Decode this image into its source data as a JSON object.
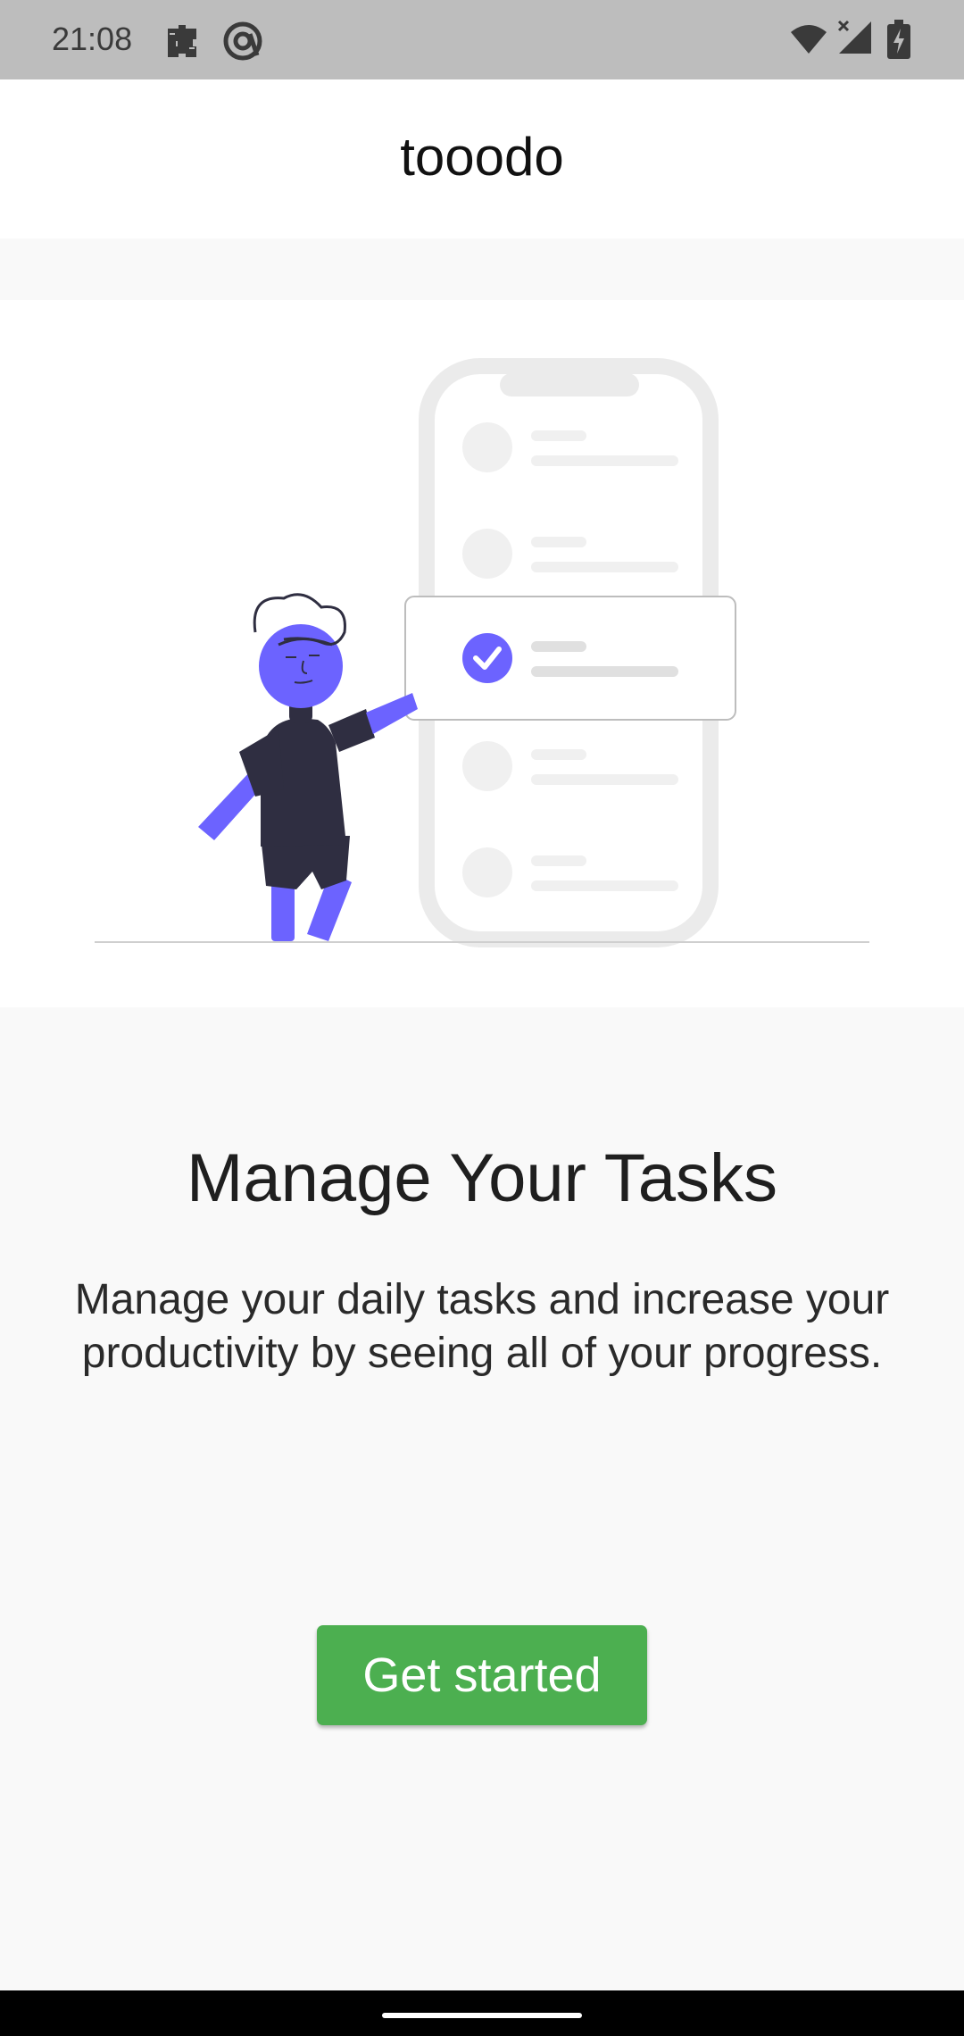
{
  "status_bar": {
    "time": "21:08",
    "icons": [
      "puzzle-icon",
      "no-disturb-icon",
      "wifi-icon",
      "signal-icon",
      "battery-charging-icon"
    ]
  },
  "app_bar": {
    "title": "tooodo"
  },
  "onboarding": {
    "headline": "Manage Your Tasks",
    "description": "Manage your daily tasks and increase your productivity by seeing all of your progress.",
    "cta_label": "Get started"
  },
  "colors": {
    "status_bar_bg": "#bdbdbd",
    "app_bar_bg": "#ffffff",
    "page_bg": "#f9f9f9",
    "accent_purple": "#6c63ff",
    "figure_dark": "#2f2e41",
    "button_green": "#4caf50",
    "placeholder_gray": "#f0f0f0"
  }
}
